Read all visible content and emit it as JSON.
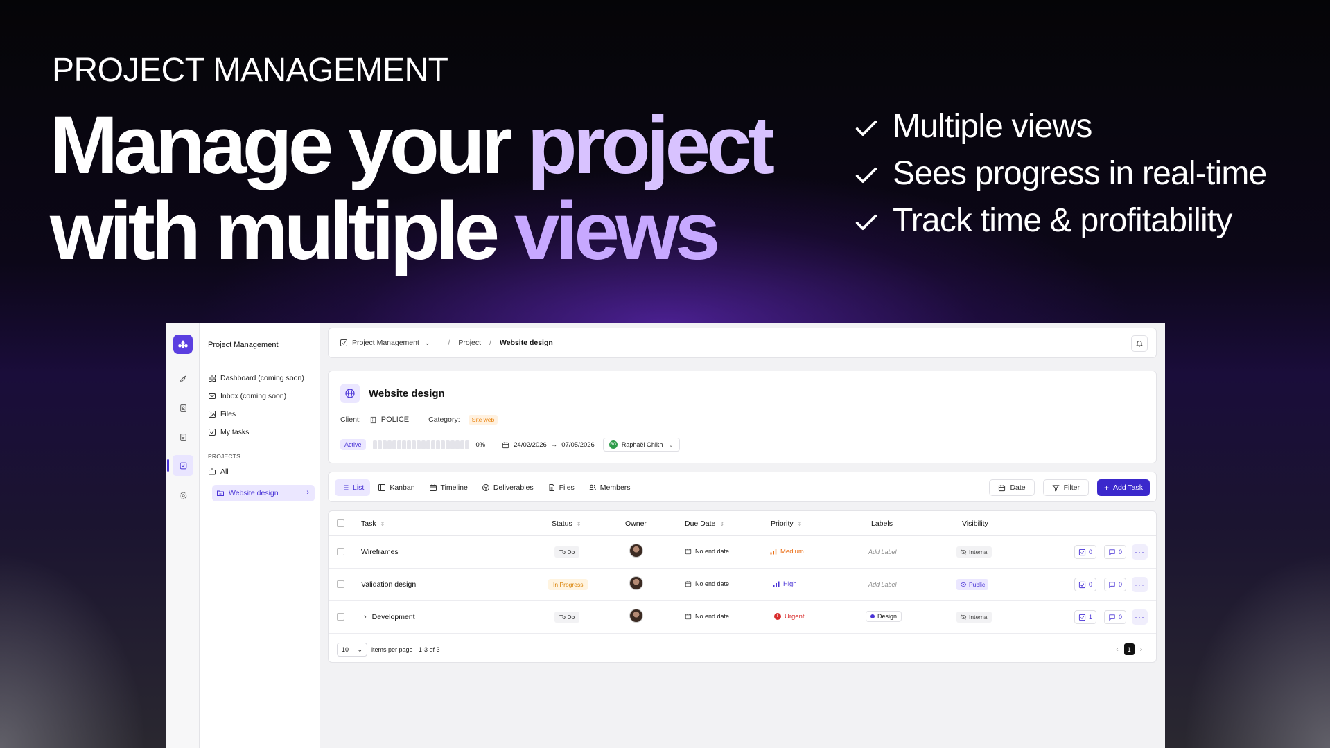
{
  "hero": {
    "eyebrow": "PROJECT MANAGEMENT",
    "title_w1": "Manage",
    "title_w2": "your",
    "title_w3": "project",
    "title_w4": "with",
    "title_w5": "multiple",
    "title_w6": "views",
    "features": [
      "Multiple views",
      "Sees progress in real-time",
      "Track time & profitability"
    ]
  },
  "colors": {
    "brand": "#3b28cc",
    "accent_light": "#ebe7ff",
    "accent_text": "#4a34d6"
  },
  "sidebar": {
    "workspace": "Project Management",
    "nav": [
      {
        "label": "Dashboard (coming soon)",
        "icon": "dashboard-icon"
      },
      {
        "label": "Inbox (coming soon)",
        "icon": "mail-icon"
      },
      {
        "label": "Files",
        "icon": "image-icon"
      },
      {
        "label": "My tasks",
        "icon": "checkbox-icon"
      }
    ],
    "projects_heading": "PROJECTS",
    "all_label": "All",
    "active_project": "Website design"
  },
  "breadcrumb": {
    "root": "Project Management",
    "middle": "Project",
    "current": "Website design"
  },
  "project": {
    "title": "Website design",
    "client_label": "Client:",
    "client_value": "POLICE",
    "category_label": "Category:",
    "category_value": "Site web",
    "status": "Active",
    "progress": "0%",
    "progress_fraction": 0,
    "start_date": "24/02/2026",
    "end_date": "07/05/2026",
    "owner": "Raphaël Ghikh",
    "owner_initials": "RG"
  },
  "views": {
    "tabs": [
      "List",
      "Kanban",
      "Timeline",
      "Deliverables",
      "Files",
      "Members"
    ],
    "active": "List",
    "date_btn": "Date",
    "filter_btn": "Filter",
    "add_btn": "Add Task"
  },
  "table": {
    "headers": {
      "task": "Task",
      "status": "Status",
      "owner": "Owner",
      "due": "Due Date",
      "priority": "Priority",
      "labels": "Labels",
      "visibility": "Visibility"
    },
    "rows": [
      {
        "task": "Wireframes",
        "status": "To Do",
        "due": "No end date",
        "priority": "Medium",
        "label": "Add Label",
        "visibility": "Internal",
        "subtasks": "0",
        "comments": "0"
      },
      {
        "task": "Validation design",
        "status": "In Progress",
        "due": "No end date",
        "priority": "High",
        "label": "Add Label",
        "visibility": "Public",
        "subtasks": "0",
        "comments": "0"
      },
      {
        "task": "Development",
        "status": "To Do",
        "due": "No end date",
        "priority": "Urgent",
        "label": "Design",
        "visibility": "Internal",
        "subtasks": "1",
        "comments": "0"
      }
    ],
    "per_page": "10",
    "per_page_label": "items per page",
    "range": "1-3 of 3",
    "page": "1"
  }
}
